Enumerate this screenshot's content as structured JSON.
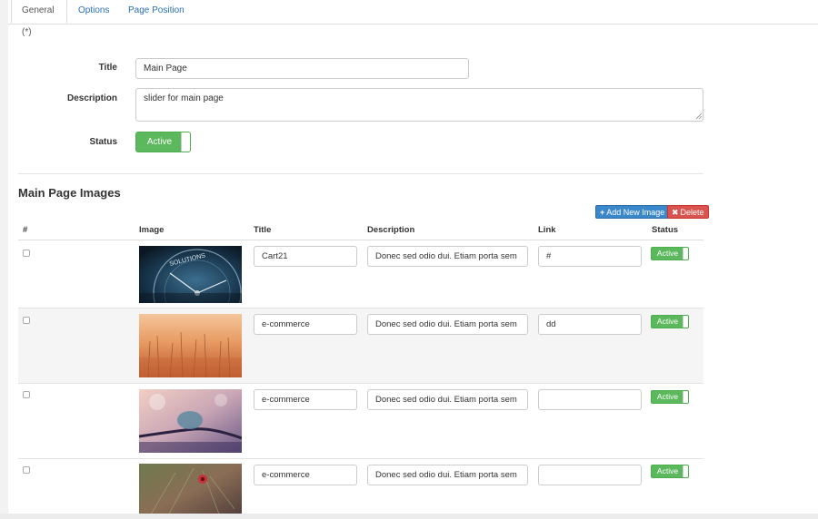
{
  "tabs": [
    {
      "label": "General (*)",
      "active": true
    },
    {
      "label": "Options",
      "active": false
    },
    {
      "label": "Page Position",
      "active": false
    }
  ],
  "form": {
    "title_label": "Title",
    "title_value": "Main Page",
    "description_label": "Description",
    "description_value": "slider for main page",
    "status_label": "Status",
    "status_value": "Active"
  },
  "images_section": {
    "heading": "Main Page Images",
    "add_button": "Add New Image",
    "delete_button": "Delete",
    "columns": [
      "#",
      "Image",
      "Title",
      "Description",
      "Link",
      "Status"
    ],
    "rows": [
      {
        "title": "Cart21",
        "description": "Donec sed odio dui. Etiam porta sem malesuada magna mollis euismod.",
        "link": "#",
        "status": "Active",
        "image": "compass-solutions-photo"
      },
      {
        "title": "e-commerce",
        "description": "Donec sed odio dui. Etiam porta sem malesuada magna mollis euismod.",
        "link": "dd",
        "status": "Active",
        "image": "wheat-field-photo"
      },
      {
        "title": "e-commerce",
        "description": "Donec sed odio dui. Etiam porta sem malesuada magna mollis euismod.",
        "link": "",
        "status": "Active",
        "image": "branch-bokeh-photo"
      },
      {
        "title": "e-commerce",
        "description": "Donec sed odio dui. Etiam porta sem malesuada magna mollis euismod.",
        "link": "",
        "status": "Active",
        "image": "red-flower-photo"
      }
    ]
  },
  "colors": {
    "accent": "#2a6fb6",
    "success": "#5cb85c",
    "primary_button": "#3a87c9",
    "danger_button": "#d9534f"
  }
}
